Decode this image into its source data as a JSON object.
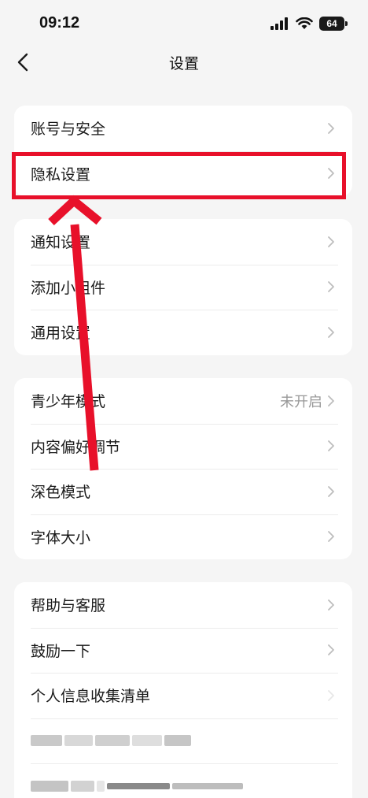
{
  "status_bar": {
    "time": "09:12",
    "battery": "64"
  },
  "header": {
    "title": "设置"
  },
  "groups": [
    {
      "items": [
        {
          "label": "账号与安全"
        },
        {
          "label": "隐私设置"
        }
      ]
    },
    {
      "items": [
        {
          "label": "通知设置"
        },
        {
          "label": "添加小组件"
        },
        {
          "label": "通用设置"
        }
      ]
    },
    {
      "items": [
        {
          "label": "青少年模式",
          "value": "未开启"
        },
        {
          "label": "内容偏好调节"
        },
        {
          "label": "深色模式"
        },
        {
          "label": "字体大小"
        }
      ]
    },
    {
      "items": [
        {
          "label": "帮助与客服"
        },
        {
          "label": "鼓励一下"
        },
        {
          "label": "个人信息收集清单"
        }
      ]
    }
  ],
  "annotation": {
    "highlight_color": "#e8102a",
    "highlighted_item": "隐私设置"
  }
}
